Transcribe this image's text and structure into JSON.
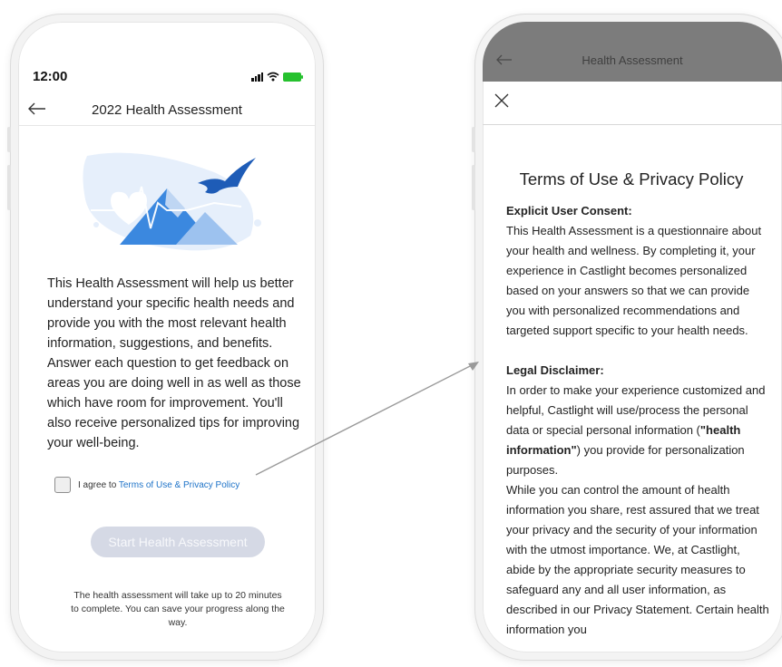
{
  "left_screen": {
    "status_time": "12:00",
    "nav_title": "2022 Health Assessment",
    "intro_text": "This Health Assessment will help us better understand your specific health needs and provide you with the most relevant health information, suggestions, and benefits. Answer each question to get feedback on areas you are doing well in as well as those which have room for improvement. You'll also receive personalized tips for improving your well-being.",
    "agree_prefix": "I agree to ",
    "agree_link": "Terms of Use & Privacy Policy",
    "start_button": "Start Health Assessment",
    "footnote": "The health assessment will take up to 20 minutes to complete. You can save your progress along the way.",
    "icons": [
      "back-arrow-icon",
      "signal-icon",
      "wifi-icon",
      "battery-icon",
      "health-illustration"
    ]
  },
  "right_screen": {
    "header_title": "Health Assessment",
    "title": "Terms of Use & Privacy Policy",
    "consent_heading": "Explicit User Consent:",
    "consent_text": "This Health Assessment is a questionnaire about your health and wellness. By completing it, your experience in Castlight becomes personalized based on your answers so that we can provide you with personalized recommendations and targeted support specific to your health needs.",
    "disclaimer_heading": "Legal Disclaimer:",
    "disclaimer_p1_before": "In order to make your experience customized and helpful, Castlight will use/process the personal data or special personal information (",
    "disclaimer_p1_bold": "\"health information\"",
    "disclaimer_p1_after": ") you provide for personalization purposes.",
    "disclaimer_p2": "While you can control the amount of health information you share, rest assured that we treat your privacy and the security of your information with the utmost importance. We, at Castlight, abide by the appropriate security measures to safeguard any and all user information, as described in our Privacy Statement. Certain health information you",
    "icons": [
      "close-icon",
      "back-arrow-icon"
    ]
  },
  "colors": {
    "link": "#1e73c8",
    "button_disabled": "#d5d9e5",
    "overlay_header": "#7c7c7c",
    "battery": "#26c12e",
    "illustration_blue": "#2f6fd6"
  }
}
